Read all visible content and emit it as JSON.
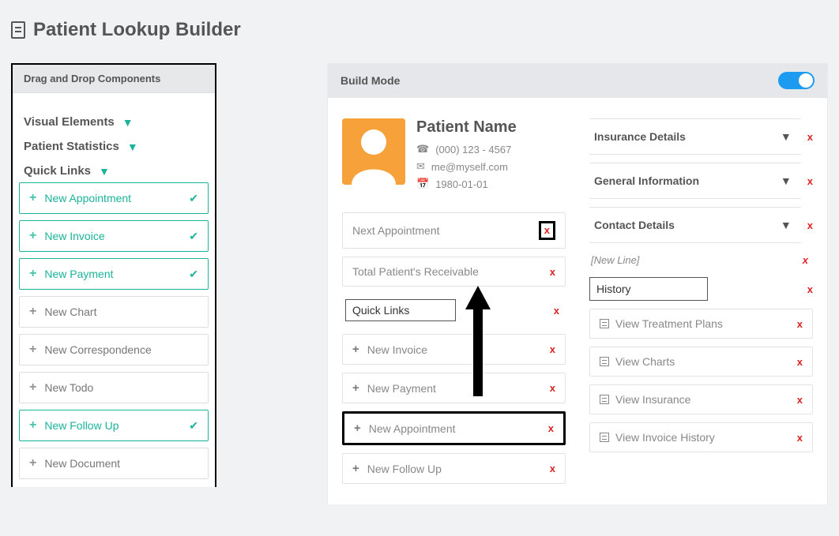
{
  "page": {
    "title": "Patient Lookup Builder"
  },
  "leftPanel": {
    "header": "Drag and Drop Components",
    "sections": {
      "visual": "Visual Elements",
      "stats": "Patient Statistics",
      "quick": "Quick Links"
    },
    "quickLinks": [
      {
        "label": "New Appointment",
        "checked": true
      },
      {
        "label": "New Invoice",
        "checked": true
      },
      {
        "label": "New Payment",
        "checked": true
      },
      {
        "label": "New Chart",
        "checked": false
      },
      {
        "label": "New Correspondence",
        "checked": false
      },
      {
        "label": "New Todo",
        "checked": false
      },
      {
        "label": "New Follow Up",
        "checked": true
      },
      {
        "label": "New Document",
        "checked": false
      }
    ]
  },
  "build": {
    "header": "Build Mode",
    "patient": {
      "nameLabel": "Patient Name",
      "phone": "(000) 123 - 4567",
      "email": "me@myself.com",
      "dob": "1980-01-01"
    },
    "leftCol": {
      "nextAppt": "Next Appointment",
      "receivable": "Total Patient's Receivable",
      "quickLinksLabel": "Quick Links",
      "items": [
        "New Invoice",
        "New Payment",
        "New Appointment",
        "New Follow Up"
      ]
    },
    "rightCol": {
      "accordions": [
        "Insurance Details",
        "General Information",
        "Contact Details"
      ],
      "newLine": "[New Line]",
      "historyLabel": "History",
      "viewLinks": [
        "View Treatment Plans",
        "View Charts",
        "View Insurance",
        "View Invoice History"
      ]
    }
  }
}
